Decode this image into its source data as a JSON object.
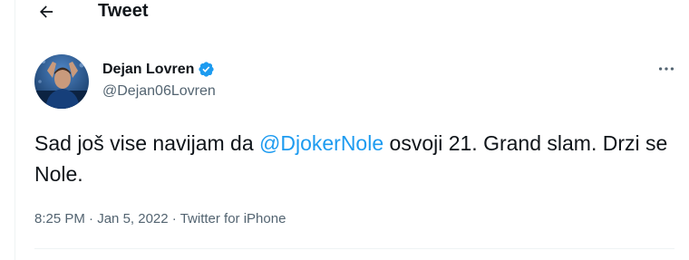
{
  "header": {
    "back_icon": "arrow-left-icon",
    "title": "Tweet"
  },
  "author": {
    "display_name": "Dejan Lovren",
    "handle": "@Dejan06Lovren",
    "verified": true,
    "verified_icon": "verified-badge-icon",
    "verified_color": "#1d9bf0"
  },
  "more_icon": "more-horizontal-icon",
  "tweet": {
    "text_before": "Sad još vise navijam da ",
    "mention": "@DjokerNole",
    "text_after": " osvoji 21. Grand slam. Drzi se Nole.",
    "time": "8:25 PM",
    "separator_1": " · ",
    "date": "Jan 5, 2022",
    "separator_2": " · ",
    "source": "Twitter for iPhone"
  },
  "colors": {
    "text": "#0f1419",
    "secondary": "#536471",
    "accent": "#1d9bf0",
    "border": "#eff3f4"
  }
}
